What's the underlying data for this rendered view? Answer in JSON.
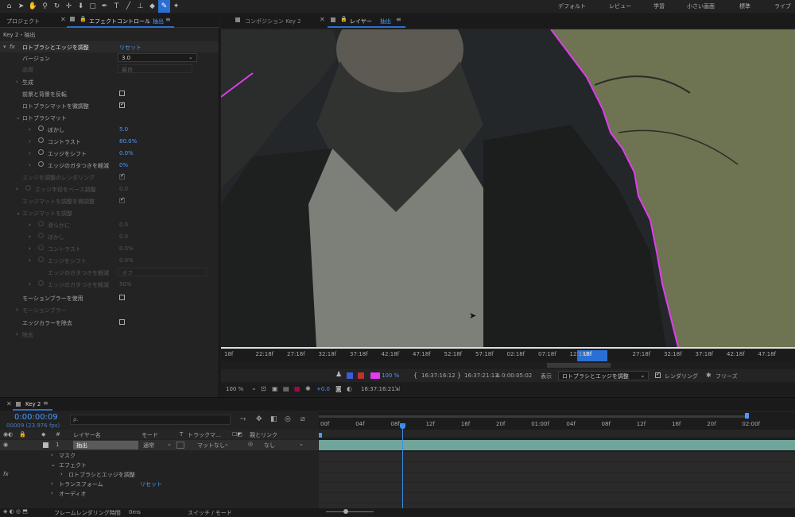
{
  "workspaces": [
    "デフォルト",
    "レビュー",
    "学習",
    "小さい画面",
    "標準",
    "ライブ"
  ],
  "toolbar_icons": [
    "home-icon",
    "selection-arrow-icon",
    "hand-icon",
    "zoom-icon",
    "rotate-icon",
    "move-anchor-icon",
    "camera-icon",
    "rect-tool-icon",
    "pen-tool-icon",
    "text-tool-icon",
    "brush-icon",
    "clone-stamp-icon",
    "eraser-icon",
    "roto-brush-icon",
    "puppet-pin-icon"
  ],
  "left_tabs": {
    "project": "プロジェクト",
    "effect_controls": "エフェクトコントロール",
    "effect_layer": "抽出"
  },
  "effect_panel": {
    "header": "Key 2・抽出",
    "effect_name": "ロトブラシとエッジを調整",
    "reset": "リセット",
    "version_label": "バージョン",
    "version_value": "3.0",
    "quality_label": "品質",
    "quality_value": "最良",
    "gen_label": "生成",
    "invert_label": "前景と背景を反転",
    "refine_label": "ロトブラシマットを微調整",
    "roto_matte": "ロトブラシマット",
    "feather_label": "ぼかし",
    "feather_value": "5.0",
    "contrast_label": "コントラスト",
    "contrast_value": "80.0%",
    "shift_label": "エッジをシフト",
    "shift_value": "0.0%",
    "chatter_label": "エッジのガタつきを軽減",
    "chatter_value": "0%",
    "edge_render_label": "エッジを調整のレンダリング",
    "edge_radius_label": "エッジ半径をベース調整",
    "edge_radius_value": "0.0",
    "edge_matte_label": "エッジマットを調整を微調整",
    "edge_matte_section": "エッジマットを調整",
    "smooth_label": "滑らかに",
    "smooth_value": "0.0",
    "feather2_label": "ぼかし",
    "feather2_value": "0.0",
    "contrast2_label": "コントラスト",
    "contrast2_value": "0.0%",
    "shift2_label": "エッジをシフト",
    "shift2_value": "0.0%",
    "chatter2_label": "エッジのガタつきを軽減",
    "chatter2_value": "オフ",
    "chatter3_label": "エッジのガタつきを軽減",
    "chatter3_value": "50%",
    "mblur_label": "モーションブラーを使用",
    "mblur_section": "モーションブラー",
    "decon_label": "エッジカラーを除去",
    "decon_section": "除去"
  },
  "viewer_tabs": {
    "comp": "コンポジション Key 2",
    "layer": "レイヤー",
    "layer_name": "抽出"
  },
  "viewer_ruler": [
    "18f",
    "22:18f",
    "27:18f",
    "32:18f",
    "37:18f",
    "42:18f",
    "47:18f",
    "52:18f",
    "57:18f",
    "02:18f",
    "07:18f",
    "12:18f",
    "2:18f",
    "27:18f",
    "32:18f",
    "37:18f",
    "42:18f",
    "47:18f"
  ],
  "viewer_ruler_current": "18f",
  "viewer_ctrl": {
    "pct": "100 %",
    "t1": "16:37:16:12",
    "t2": "16:37:21:13",
    "dur": "Δ 0:00:05:02",
    "show": "表示",
    "view": "ロトブラシとエッジを調整",
    "render": "レンダリング",
    "freeze": "フリーズ"
  },
  "viewer_bottom": {
    "zoom": "100 %",
    "exposure": "+0.0",
    "time": "16:37:16:21"
  },
  "colors": {
    "accent": "#2b6fd4",
    "roto_outline": "#e03cf0",
    "current_time": "#3a8ee6"
  },
  "timeline": {
    "tab": "Key 2",
    "timecode": "0:00:00:09",
    "fps": "00009 (23.976 fps)",
    "search_placeholder": "ρ.",
    "headers": {
      "num": "#",
      "name": "レイヤー名",
      "mode": "モード",
      "t": "T",
      "trk": "トラックマ…",
      "parent": "親とリンク"
    },
    "layer": {
      "num": "1",
      "name": "抽出",
      "mode": "通常",
      "matte": "マットなし",
      "parent": "なし"
    },
    "children": [
      "マスク",
      "エフェクト",
      "ロトブラシとエッジを調整",
      "トランスフォーム",
      "オーディオ"
    ],
    "reset": "リセット",
    "ruler": [
      "00f",
      "04f",
      "08f",
      "12f",
      "16f",
      "20f",
      "01:00f",
      "04f",
      "08f",
      "12f",
      "16f",
      "20f",
      "02:00f"
    ]
  },
  "status": {
    "frame_time_label": "フレームレンダリング時間",
    "frame_time": "0ms",
    "switch_mode": "スイッチ / モード"
  }
}
